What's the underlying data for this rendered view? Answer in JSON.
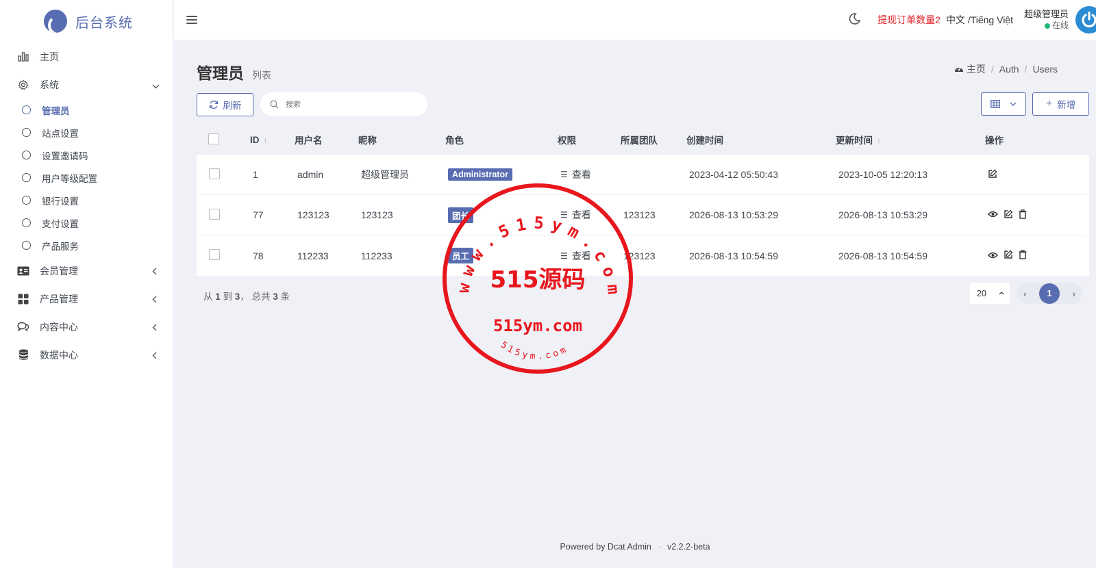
{
  "brand": {
    "name": "后台系统"
  },
  "sidebar": {
    "items": [
      {
        "label": "主页"
      },
      {
        "label": "系统"
      },
      {
        "label": "会员管理"
      },
      {
        "label": "产品管理"
      },
      {
        "label": "内容中心"
      },
      {
        "label": "数据中心"
      }
    ],
    "system_sub": [
      {
        "label": "管理员",
        "active": true
      },
      {
        "label": "站点设置"
      },
      {
        "label": "设置邀请码"
      },
      {
        "label": "用户等级配置"
      },
      {
        "label": "银行设置"
      },
      {
        "label": "支付设置"
      },
      {
        "label": "产品服务"
      }
    ]
  },
  "topbar": {
    "withdraw_notice": "提现订单数量2",
    "language": "中文 /Tiếng Việt",
    "user_name": "超级管理员",
    "user_status": "在线"
  },
  "page": {
    "title": "管理员",
    "subtitle": "列表",
    "breadcrumb": [
      "主页",
      "Auth",
      "Users"
    ]
  },
  "toolbar": {
    "refresh_label": "刷新",
    "search_placeholder": "搜索",
    "add_label": "新增"
  },
  "table": {
    "headers": [
      "ID",
      "用户名",
      "昵称",
      "角色",
      "权限",
      "所属团队",
      "创建时间",
      "更新时间",
      "操作"
    ],
    "perm_label": "查看",
    "rows": [
      {
        "id": "1",
        "username": "admin",
        "nickname": "超级管理员",
        "role": "Administrator",
        "team": "",
        "created": "2023-04-12 05:50:43",
        "updated": "2023-10-05 12:20:13"
      },
      {
        "id": "77",
        "username": "123123",
        "nickname": "123123",
        "role": "团长",
        "team": "123123",
        "created": "2026-08-13 10:53:29",
        "updated": "2026-08-13 10:53:29"
      },
      {
        "id": "78",
        "username": "112233",
        "nickname": "112233",
        "role": "员工",
        "team": "123123",
        "created": "2026-08-13 10:54:59",
        "updated": "2026-08-13 10:54:59"
      }
    ]
  },
  "pagination": {
    "from": "1",
    "to": "3",
    "total": "3",
    "per_page": "20",
    "current_page": "1"
  },
  "footer": {
    "powered_by": "Powered by Dcat Admin",
    "version": "v2.2.2-beta"
  },
  "watermark": {
    "main_text": "515源码",
    "url_text": "515ym.com",
    "ring_text": "www.515ym.com",
    "small_ring_text": "515ym.com"
  },
  "colors": {
    "primary": "#586cb1",
    "alert": "#e4202a",
    "online": "#21b978",
    "stamp": "#e8161d"
  }
}
